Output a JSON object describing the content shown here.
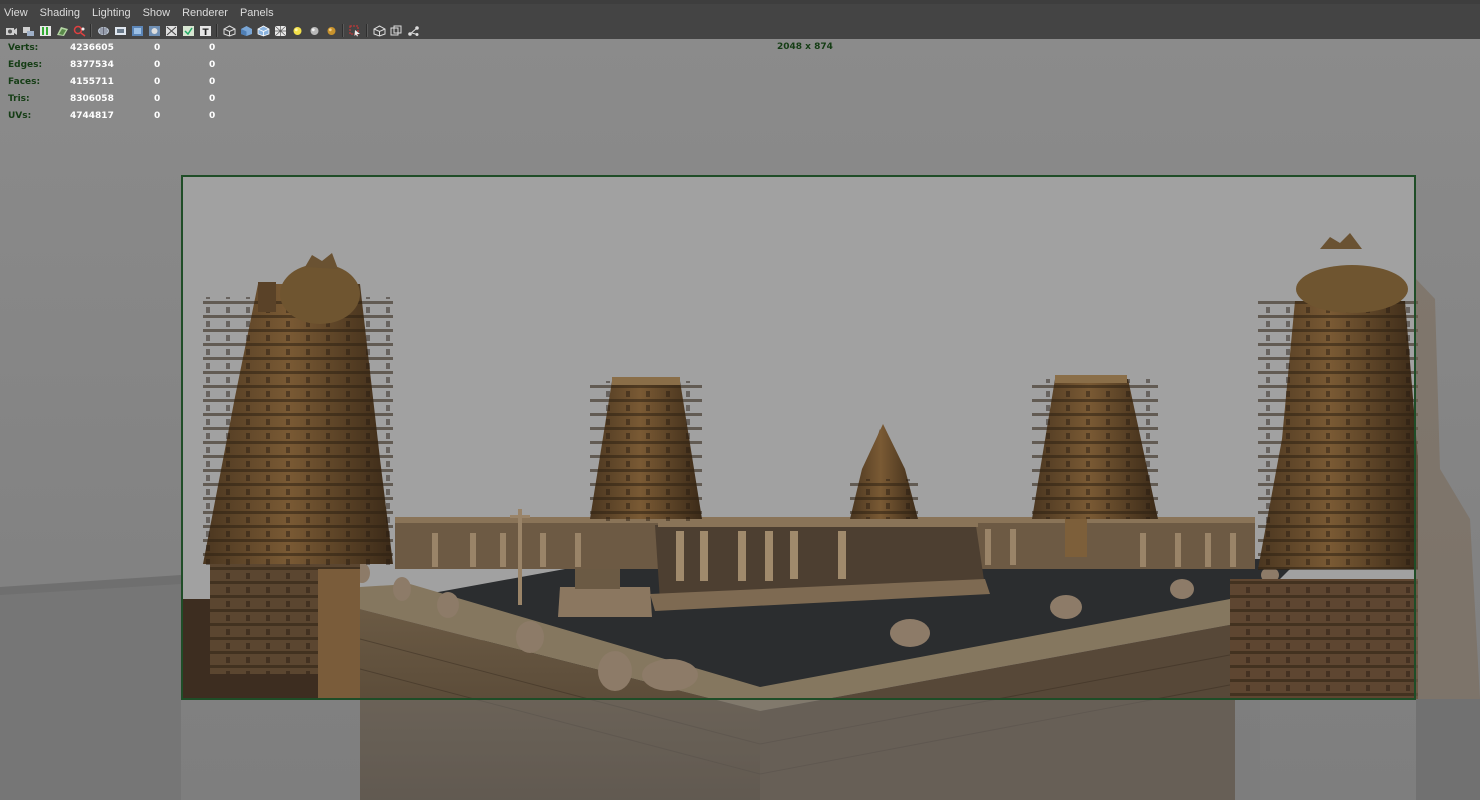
{
  "menu": {
    "items": [
      "View",
      "Shading",
      "Lighting",
      "Show",
      "Renderer",
      "Panels"
    ]
  },
  "toolbar": {
    "icons": [
      "camera-icon",
      "camera-attributes-icon",
      "bookmark-icon",
      "image-plane-icon",
      "2d-pan-zoom-icon",
      "grid-icon",
      "film-gate-icon",
      "resolution-gate-icon",
      "gate-mask-icon",
      "field-chart-icon",
      "safe-action-icon",
      "safe-title-icon",
      "wireframe-icon",
      "smooth-shade-icon",
      "wireframe-on-shaded-icon",
      "xray-icon",
      "default-light-icon",
      "shadows-icon",
      "texture-icon",
      "isolate-select-icon",
      "xray-joints-icon",
      "xray-active-icon",
      "joint-xray-icon"
    ]
  },
  "hud": {
    "rows": [
      {
        "label": "Verts:",
        "v1": "4236605",
        "v2": "0",
        "v3": "0"
      },
      {
        "label": "Edges:",
        "v1": "8377534",
        "v2": "0",
        "v3": "0"
      },
      {
        "label": "Faces:",
        "v1": "4155711",
        "v2": "0",
        "v3": "0"
      },
      {
        "label": "Tris:",
        "v1": "8306058",
        "v2": "0",
        "v3": "0"
      },
      {
        "label": "UVs:",
        "v1": "4744817",
        "v2": "0",
        "v3": "0"
      }
    ],
    "resolution": "2048 x 874"
  },
  "colors": {
    "hud_label": "#153d15",
    "gate_border": "#1f4d27",
    "stone": "#6b5030",
    "courtyard": "#2a2a2a"
  }
}
